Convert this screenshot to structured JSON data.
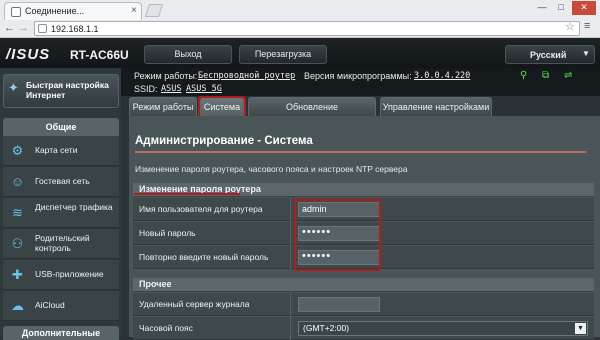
{
  "browser": {
    "tab_title": "Соединение...",
    "tab_close": "×",
    "url": "192.168.1.1",
    "star": "☆",
    "menu": "≡",
    "back": "←",
    "forward": "→",
    "win_min": "—",
    "win_max": "□",
    "win_close": "✕"
  },
  "header": {
    "logo": "/ISUS",
    "model": "RT-AC66U",
    "logout": "Выход",
    "reboot": "Перезагрузка",
    "language": "Русский",
    "language_arrow": "▼"
  },
  "status": {
    "mode_label": "Режим работы:",
    "mode_value": "Беспроводной роутер",
    "fw_label": "Версия микропрограммы:",
    "fw_value": "3.0.0.4.220",
    "ssid_label": "SSID:",
    "ssid_1": "ASUS",
    "ssid_2": "ASUS_5G",
    "icons": [
      "person-icon",
      "copy-icon",
      "usb-icon"
    ],
    "accent_color": "#55e14a"
  },
  "sidebar": {
    "quick_setup": "Быстрая настройка Интернет",
    "general_header": "Общие",
    "items": [
      {
        "label": "Карта сети",
        "icon": "network-map-icon"
      },
      {
        "label": "Гостевая сеть",
        "icon": "guest-network-icon"
      },
      {
        "label": "Диспетчер трафика",
        "icon": "traffic-manager-icon"
      },
      {
        "label": "Родительский контроль",
        "icon": "parental-control-icon"
      },
      {
        "label": "USB-приложение",
        "icon": "usb-app-icon"
      },
      {
        "label": "AiCloud",
        "icon": "cloud-icon"
      }
    ],
    "extra_header": "Дополнительные"
  },
  "tabs": [
    {
      "label": "Режим работы",
      "active": false
    },
    {
      "label": "Система",
      "active": true
    },
    {
      "label": "Обновление микропрограммы",
      "active": false
    },
    {
      "label": "Управление настройками",
      "active": false
    }
  ],
  "main": {
    "title": "Администрирование - Система",
    "description": "Изменение пароля роутера, часового пояса и настроек NTP сервера",
    "password_group": {
      "header": "Изменение пароля роутера",
      "username_label": "Имя пользователя для роутера",
      "username_value": "admin",
      "new_password_label": "Новый пароль",
      "new_password_value": "••••••",
      "repeat_password_label": "Повторно введите новый пароль",
      "repeat_password_value": "••••••"
    },
    "misc_group": {
      "header": "Прочее",
      "syslog_label": "Удаленный сервер журнала",
      "syslog_value": "",
      "timezone_label": "Часовой пояс",
      "timezone_value": "(GMT+2:00)",
      "timezone_arrow": "▼"
    },
    "highlight_color": "#b01b1b"
  }
}
